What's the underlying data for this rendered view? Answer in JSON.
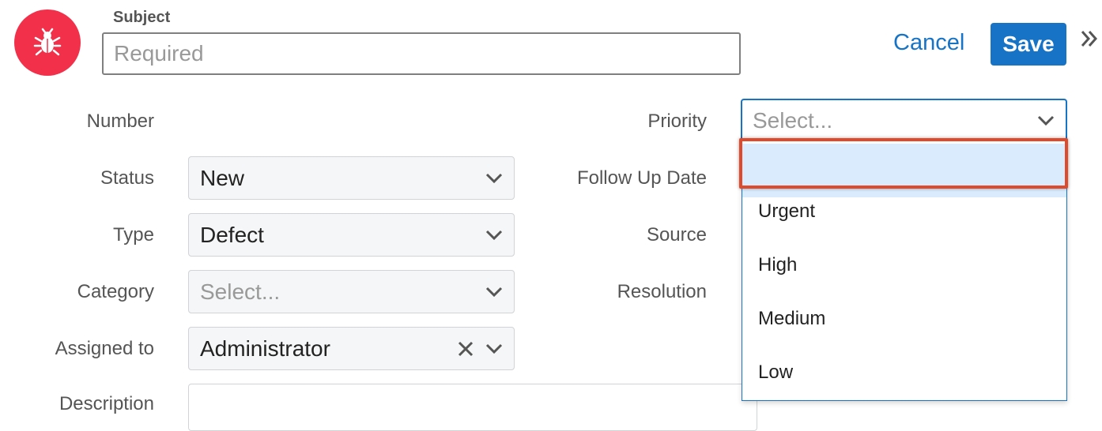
{
  "header": {
    "record_icon": "bug-icon",
    "subject_label": "Subject",
    "subject_placeholder": "Required",
    "cancel_label": "Cancel",
    "save_label": "Save",
    "more_icon": "double-chevron-right-icon"
  },
  "form": {
    "number_label": "Number",
    "status_label": "Status",
    "status_value": "New",
    "type_label": "Type",
    "type_value": "Defect",
    "category_label": "Category",
    "category_placeholder": "Select...",
    "assigned_label": "Assigned to",
    "assigned_value": "Administrator",
    "description_label": "Description",
    "priority_label": "Priority",
    "priority_placeholder": "Select...",
    "followup_label": "Follow Up Date",
    "source_label": "Source",
    "resolution_label": "Resolution"
  },
  "priority_dropdown": {
    "options": [
      "",
      "Urgent",
      "High",
      "Medium",
      "Low"
    ],
    "highlighted_index": 0
  },
  "colors": {
    "accent": "#1673c6",
    "record_icon_bg": "#f3304a",
    "annotation": "#e04a2c"
  }
}
